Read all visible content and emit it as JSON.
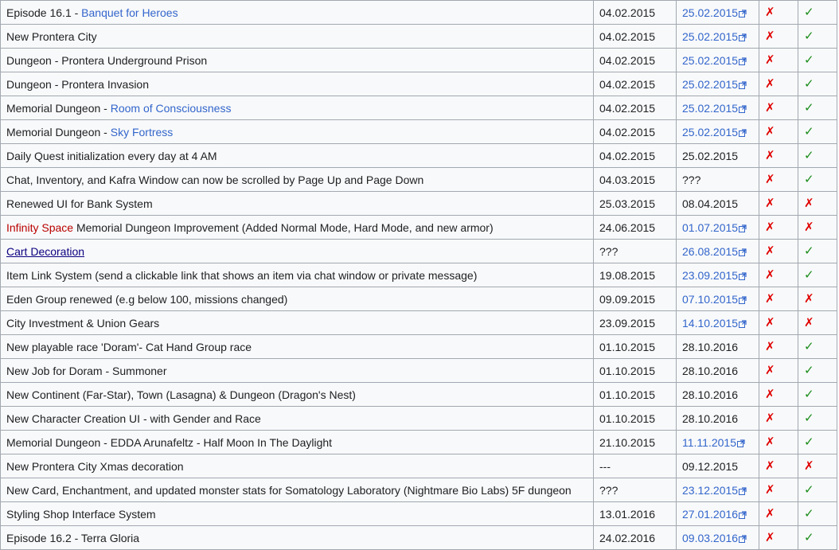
{
  "table": {
    "rows": [
      {
        "feature": {
          "prefix": "Episode 16.1 - ",
          "text": "Banquet for Heroes",
          "style": "link"
        },
        "kro": "04.02.2015",
        "iro": "25.02.2015",
        "iro_external": true,
        "f1": "no",
        "f2": "yes"
      },
      {
        "feature": {
          "prefix": "",
          "text": "New Prontera City",
          "style": "plain"
        },
        "kro": "04.02.2015",
        "iro": "25.02.2015",
        "iro_external": true,
        "f1": "no",
        "f2": "yes"
      },
      {
        "feature": {
          "prefix": "",
          "text": "Dungeon - Prontera Underground Prison",
          "style": "plain"
        },
        "kro": "04.02.2015",
        "iro": "25.02.2015",
        "iro_external": true,
        "f1": "no",
        "f2": "yes"
      },
      {
        "feature": {
          "prefix": "",
          "text": "Dungeon - Prontera Invasion",
          "style": "plain"
        },
        "kro": "04.02.2015",
        "iro": "25.02.2015",
        "iro_external": true,
        "f1": "no",
        "f2": "yes"
      },
      {
        "feature": {
          "prefix": "Memorial Dungeon - ",
          "text": "Room of Consciousness",
          "style": "link"
        },
        "kro": "04.02.2015",
        "iro": "25.02.2015",
        "iro_external": true,
        "f1": "no",
        "f2": "yes"
      },
      {
        "feature": {
          "prefix": "Memorial Dungeon - ",
          "text": "Sky Fortress",
          "style": "link"
        },
        "kro": "04.02.2015",
        "iro": "25.02.2015",
        "iro_external": true,
        "f1": "no",
        "f2": "yes"
      },
      {
        "feature": {
          "prefix": "",
          "text": "Daily Quest initialization every day at 4 AM",
          "style": "plain"
        },
        "kro": "04.02.2015",
        "iro": "25.02.2015",
        "iro_external": false,
        "f1": "no",
        "f2": "yes"
      },
      {
        "feature": {
          "prefix": "",
          "text": "Chat, Inventory, and Kafra Window can now be scrolled by Page Up and Page Down",
          "style": "plain"
        },
        "kro": "04.03.2015",
        "iro": "???",
        "iro_external": false,
        "f1": "no",
        "f2": "yes"
      },
      {
        "feature": {
          "prefix": "",
          "text": "Renewed UI for Bank System",
          "style": "plain"
        },
        "kro": "25.03.2015",
        "iro": "08.04.2015",
        "iro_external": false,
        "f1": "no",
        "f2": "no"
      },
      {
        "feature": {
          "prefix": "",
          "text": "Infinity Space",
          "suffix": " Memorial Dungeon Improvement (Added Normal Mode, Hard Mode, and new armor)",
          "style": "link-red"
        },
        "kro": "24.06.2015",
        "iro": "01.07.2015",
        "iro_external": true,
        "f1": "no",
        "f2": "no"
      },
      {
        "feature": {
          "prefix": "",
          "text": "Cart Decoration",
          "style": "link-visited"
        },
        "kro": "???",
        "iro": "26.08.2015",
        "iro_external": true,
        "f1": "no",
        "f2": "yes"
      },
      {
        "feature": {
          "prefix": "",
          "text": "Item Link System (send a clickable link that shows an item via chat window or private message)",
          "style": "plain"
        },
        "kro": "19.08.2015",
        "iro": "23.09.2015",
        "iro_external": true,
        "f1": "no",
        "f2": "yes"
      },
      {
        "feature": {
          "prefix": "",
          "text": "Eden Group renewed (e.g below 100, missions changed)",
          "style": "plain"
        },
        "kro": "09.09.2015",
        "iro": "07.10.2015",
        "iro_external": true,
        "f1": "no",
        "f2": "no"
      },
      {
        "feature": {
          "prefix": "",
          "text": "City Investment & Union Gears",
          "style": "plain"
        },
        "kro": "23.09.2015",
        "iro": "14.10.2015",
        "iro_external": true,
        "f1": "no",
        "f2": "no"
      },
      {
        "feature": {
          "prefix": "",
          "text": "New playable race 'Doram'- Cat Hand Group race",
          "style": "plain"
        },
        "kro": "01.10.2015",
        "iro": "28.10.2016",
        "iro_external": false,
        "f1": "no",
        "f2": "yes"
      },
      {
        "feature": {
          "prefix": "",
          "text": "New Job for Doram - Summoner",
          "style": "plain"
        },
        "kro": "01.10.2015",
        "iro": "28.10.2016",
        "iro_external": false,
        "f1": "no",
        "f2": "yes"
      },
      {
        "feature": {
          "prefix": "",
          "text": "New Continent (Far-Star), Town (Lasagna) & Dungeon (Dragon's Nest)",
          "style": "plain"
        },
        "kro": "01.10.2015",
        "iro": "28.10.2016",
        "iro_external": false,
        "f1": "no",
        "f2": "yes"
      },
      {
        "feature": {
          "prefix": "",
          "text": "New Character Creation UI - with Gender and Race",
          "style": "plain"
        },
        "kro": "01.10.2015",
        "iro": "28.10.2016",
        "iro_external": false,
        "f1": "no",
        "f2": "yes"
      },
      {
        "feature": {
          "prefix": "",
          "text": "Memorial Dungeon - EDDA Arunafeltz - Half Moon In The Daylight",
          "style": "plain"
        },
        "kro": "21.10.2015",
        "iro": "11.11.2015",
        "iro_external": true,
        "f1": "no",
        "f2": "yes"
      },
      {
        "feature": {
          "prefix": "",
          "text": "New Prontera City Xmas decoration",
          "style": "plain"
        },
        "kro": "---",
        "iro": "09.12.2015",
        "iro_external": false,
        "f1": "no",
        "f2": "no"
      },
      {
        "feature": {
          "prefix": "",
          "text": "New Card, Enchantment, and updated monster stats for Somatology Laboratory (Nightmare Bio Labs) 5F dungeon",
          "style": "plain"
        },
        "kro": "???",
        "iro": "23.12.2015",
        "iro_external": true,
        "f1": "no",
        "f2": "yes"
      },
      {
        "feature": {
          "prefix": "",
          "text": "Styling Shop Interface System",
          "style": "plain"
        },
        "kro": "13.01.2016",
        "iro": "27.01.2016",
        "iro_external": true,
        "f1": "no",
        "f2": "yes"
      },
      {
        "feature": {
          "prefix": "",
          "text": "Episode 16.2 - Terra Gloria",
          "style": "plain"
        },
        "kro": "24.02.2016",
        "iro": "09.03.2016",
        "iro_external": true,
        "f1": "no",
        "f2": "yes"
      }
    ]
  },
  "marks": {
    "yes_glyph": "✓",
    "no_glyph": "✗",
    "yes_color": "#1a8c1a",
    "no_color": "#e00000"
  },
  "colors": {
    "link": "#3366cc",
    "link_red": "#ba0000",
    "link_visited": "#0b0080",
    "border": "#a2a9b1",
    "cell_bg": "#f8f9fa"
  },
  "icons": {
    "external_link": "external-link-icon"
  }
}
